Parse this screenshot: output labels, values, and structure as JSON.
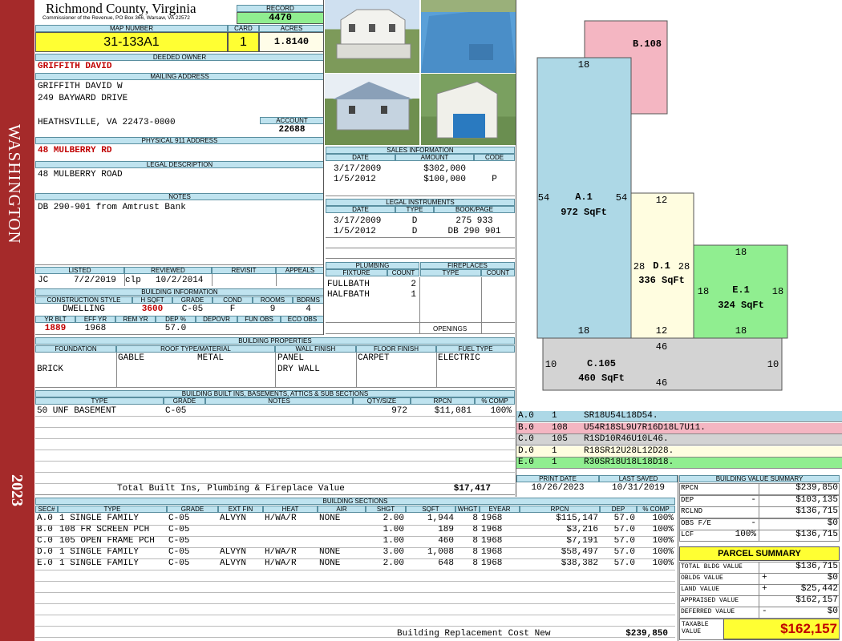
{
  "county": {
    "name": "Richmond County, Virginia",
    "subtitle": "Commissioner of the Revenue, PO Box 366, Warsaw, VA 22572"
  },
  "sidebar": {
    "district": "WASHINGTON",
    "year": "2023"
  },
  "record": {
    "label": "RECORD",
    "value": "4470"
  },
  "mapnum": {
    "label": "MAP NUMBER",
    "value": "31-133A1"
  },
  "card": {
    "label": "CARD",
    "value": "1"
  },
  "acres": {
    "label": "ACRES",
    "value": "1.8140"
  },
  "owner": {
    "label": "DEEDED OWNER",
    "value": "GRIFFITH DAVID"
  },
  "mailing": {
    "label": "MAILING ADDRESS",
    "line1": "GRIFFITH DAVID W",
    "line2": "249 BAYWARD DRIVE",
    "line3": "HEATHSVILLE, VA 22473-0000"
  },
  "account": {
    "label": "ACCOUNT",
    "value": "22688"
  },
  "physical": {
    "label": "PHYSICAL 911 ADDRESS",
    "value": "48 MULBERRY RD"
  },
  "legal": {
    "label": "LEGAL DESCRIPTION",
    "value": "48 MULBERRY ROAD"
  },
  "notes": {
    "label": "NOTES",
    "value": "DB 290-901 from Amtrust Bank"
  },
  "listed": {
    "labels": [
      "LISTED",
      "REVIEWED",
      "REVISIT",
      "APPEALS"
    ],
    "listed_by": "JC",
    "listed_date": "7/2/2019",
    "reviewed_by": "clp",
    "reviewed_date": "10/2/2014"
  },
  "building_info": {
    "label": "BUILDING INFORMATION",
    "headers": [
      "CONSTRUCTION STYLE",
      "H SQFT",
      "GRADE",
      "COND",
      "ROOMS",
      "BDRMS"
    ],
    "style": "DWELLING",
    "hsqft": "3600",
    "grade": "C-05",
    "cond": "F",
    "rooms": "9",
    "bdrms": "4",
    "headers2": [
      "YR BLT",
      "EFF YR",
      "REM YR",
      "DEP %",
      "DEPOVR",
      "FUN OBS",
      "ECO OBS"
    ],
    "yrblt": "1889",
    "effyr": "1968",
    "dep": "57.0"
  },
  "sales": {
    "label": "SALES INFORMATION",
    "headers": [
      "DATE",
      "AMOUNT",
      "CODE"
    ],
    "rows": [
      {
        "date": "3/17/2009",
        "amount": "$302,000",
        "code": ""
      },
      {
        "date": "1/5/2012",
        "amount": "$100,000",
        "code": "P"
      }
    ]
  },
  "legal_instruments": {
    "label": "LEGAL INSTRUMENTS",
    "headers": [
      "DATE",
      "TYPE",
      "BOOK/PAGE"
    ],
    "rows": [
      {
        "date": "3/17/2009",
        "type": "D",
        "book": "275 933"
      },
      {
        "date": "1/5/2012",
        "type": "D",
        "book": "DB 290 901"
      }
    ]
  },
  "plumbing": {
    "label": "PLUMBING",
    "headers": [
      "FIXTURE",
      "COUNT"
    ],
    "rows": [
      {
        "fixture": "FULLBATH",
        "count": "2"
      },
      {
        "fixture": "HALFBATH",
        "count": "1"
      }
    ]
  },
  "fireplaces": {
    "label": "FIREPLACES",
    "headers": [
      "TYPE",
      "COUNT"
    ],
    "openings": "OPENINGS"
  },
  "properties": {
    "label": "BUILDING PROPERTIES",
    "headers": [
      "FOUNDATION",
      "ROOF TYPE/MATERIAL",
      "WALL FINISH",
      "FLOOR FINISH",
      "FUEL TYPE"
    ],
    "foundation": "BRICK",
    "roof_type": "GABLE",
    "roof_mat": "METAL",
    "wall1": "PANEL",
    "wall2": "DRY WALL",
    "floor": "CARPET",
    "fuel": "ELECTRIC"
  },
  "builtins": {
    "label": "BUILDING BUILT INS, BASEMENTS, ATTICS & SUB SECTIONS",
    "headers": [
      "TYPE",
      "GRADE",
      "NOTES",
      "QTY/SIZE",
      "RPCN",
      "% COMP"
    ],
    "rows": [
      {
        "type": "50 UNF BASEMENT",
        "grade": "C-05",
        "notes": "",
        "qty": "972",
        "rpcn": "$11,081",
        "comp": "100%"
      }
    ],
    "total_label": "Total Built Ins, Plumbing & Fireplace Value",
    "total_value": "$17,417"
  },
  "sketch": {
    "areas": [
      {
        "id": "A.1",
        "sqft": "972 SqFt",
        "color": "#add8e6",
        "dims": [
          "18",
          "54",
          "54",
          "18"
        ]
      },
      {
        "id": "B.108",
        "sqft": "",
        "color": "#f4b6c2",
        "dims": []
      },
      {
        "id": "D.1",
        "sqft": "336 SqFt",
        "color": "#fffde0",
        "dims": [
          "12",
          "28",
          "28",
          "12"
        ]
      },
      {
        "id": "E.1",
        "sqft": "324 SqFt",
        "color": "#90ee90",
        "dims": [
          "18",
          "18",
          "18",
          "18"
        ]
      },
      {
        "id": "C.105",
        "sqft": "460 SqFt",
        "color": "#d3d3d3",
        "dims": [
          "46",
          "10",
          "10",
          "46"
        ]
      }
    ]
  },
  "sketch_legend": [
    {
      "sec": "A.0",
      "code": "1",
      "vec": "SR18U54L18D54.",
      "color": "#add8e6"
    },
    {
      "sec": "B.0",
      "code": "108",
      "vec": "U54R18SL9U7R16D18L7U11.",
      "color": "#f4b6c2"
    },
    {
      "sec": "C.0",
      "code": "105",
      "vec": "R1SD10R46U10L46.",
      "color": "#d3d3d3"
    },
    {
      "sec": "D.0",
      "code": "1",
      "vec": "R18SR12U28L12D28.",
      "color": "#fffde0"
    },
    {
      "sec": "E.0",
      "code": "1",
      "vec": "R30SR18U18L18D18.",
      "color": "#90ee90"
    }
  ],
  "print": {
    "labels": [
      "PRINT DATE",
      "LAST SAVED"
    ],
    "print_date": "10/26/2023",
    "last_saved": "10/31/2019"
  },
  "value_summary": {
    "label": "BUILDING VALUE SUMMARY",
    "rows": [
      {
        "label": "RPCN",
        "sign": "",
        "value": "$239,850"
      },
      {
        "label": "DEP",
        "sign": "-",
        "value": "$103,135"
      },
      {
        "label": "RCLND",
        "sign": "",
        "value": "$136,715"
      },
      {
        "label": "OBS F/E",
        "sign": "-",
        "value": "$0"
      },
      {
        "label": "LCF",
        "sign": "100%",
        "value": "$136,715"
      }
    ]
  },
  "parcel_summary": {
    "label": "PARCEL SUMMARY",
    "rows": [
      {
        "label": "TOTAL BLDG VALUE",
        "sign": "",
        "value": "$136,715"
      },
      {
        "label": "OBLDG VALUE",
        "sign": "+",
        "value": "$0"
      },
      {
        "label": "LAND VALUE",
        "sign": "+",
        "value": "$25,442"
      },
      {
        "label": "APPRAISED VALUE",
        "sign": "",
        "value": "$162,157"
      },
      {
        "label": "DEFERRED VALUE",
        "sign": "-",
        "value": "$0"
      }
    ],
    "taxable_label": "TAXABLE VALUE",
    "taxable_value": "$162,157"
  },
  "sections": {
    "label": "BUILDING SECTIONS",
    "headers": [
      "SEC#",
      "TYPE",
      "GRADE",
      "EXT FIN",
      "HEAT",
      "AIR",
      "SHGT",
      "SQFT",
      "WHGT",
      "EYEAR",
      "RPCN",
      "DEP",
      "% COMP"
    ],
    "rows": [
      {
        "sec": "A.0",
        "type": "1 SINGLE FAMILY",
        "grade": "C-05",
        "ext": "ALVYN",
        "heat": "H/WA/R",
        "air": "NONE",
        "shgt": "2.00",
        "sqft": "1,944",
        "whgt": "8",
        "eyear": "1968",
        "rpcn": "$115,147",
        "dep": "57.0",
        "comp": "100%"
      },
      {
        "sec": "B.0",
        "type": "108 FR SCREEN PCH",
        "grade": "C-05",
        "ext": "",
        "heat": "",
        "air": "",
        "shgt": "1.00",
        "sqft": "189",
        "whgt": "8",
        "eyear": "1968",
        "rpcn": "$3,216",
        "dep": "57.0",
        "comp": "100%"
      },
      {
        "sec": "C.0",
        "type": "105 OPEN FRAME PCH",
        "grade": "C-05",
        "ext": "",
        "heat": "",
        "air": "",
        "shgt": "1.00",
        "sqft": "460",
        "whgt": "8",
        "eyear": "1968",
        "rpcn": "$7,191",
        "dep": "57.0",
        "comp": "100%"
      },
      {
        "sec": "D.0",
        "type": "1 SINGLE FAMILY",
        "grade": "C-05",
        "ext": "ALVYN",
        "heat": "H/WA/R",
        "air": "NONE",
        "shgt": "3.00",
        "sqft": "1,008",
        "whgt": "8",
        "eyear": "1968",
        "rpcn": "$58,497",
        "dep": "57.0",
        "comp": "100%"
      },
      {
        "sec": "E.0",
        "type": "1 SINGLE FAMILY",
        "grade": "C-05",
        "ext": "ALVYN",
        "heat": "H/WA/R",
        "air": "NONE",
        "shgt": "2.00",
        "sqft": "648",
        "whgt": "8",
        "eyear": "1968",
        "rpcn": "$38,382",
        "dep": "57.0",
        "comp": "100%"
      }
    ],
    "total_label": "Building Replacement Cost New",
    "total_value": "$239,850"
  },
  "photos": [
    {
      "name": "house-front-photo",
      "desc": "house"
    },
    {
      "name": "pool-photo",
      "desc": "pool"
    },
    {
      "name": "house-side-photo",
      "desc": "house"
    },
    {
      "name": "shed-photo",
      "desc": "shed"
    }
  ]
}
